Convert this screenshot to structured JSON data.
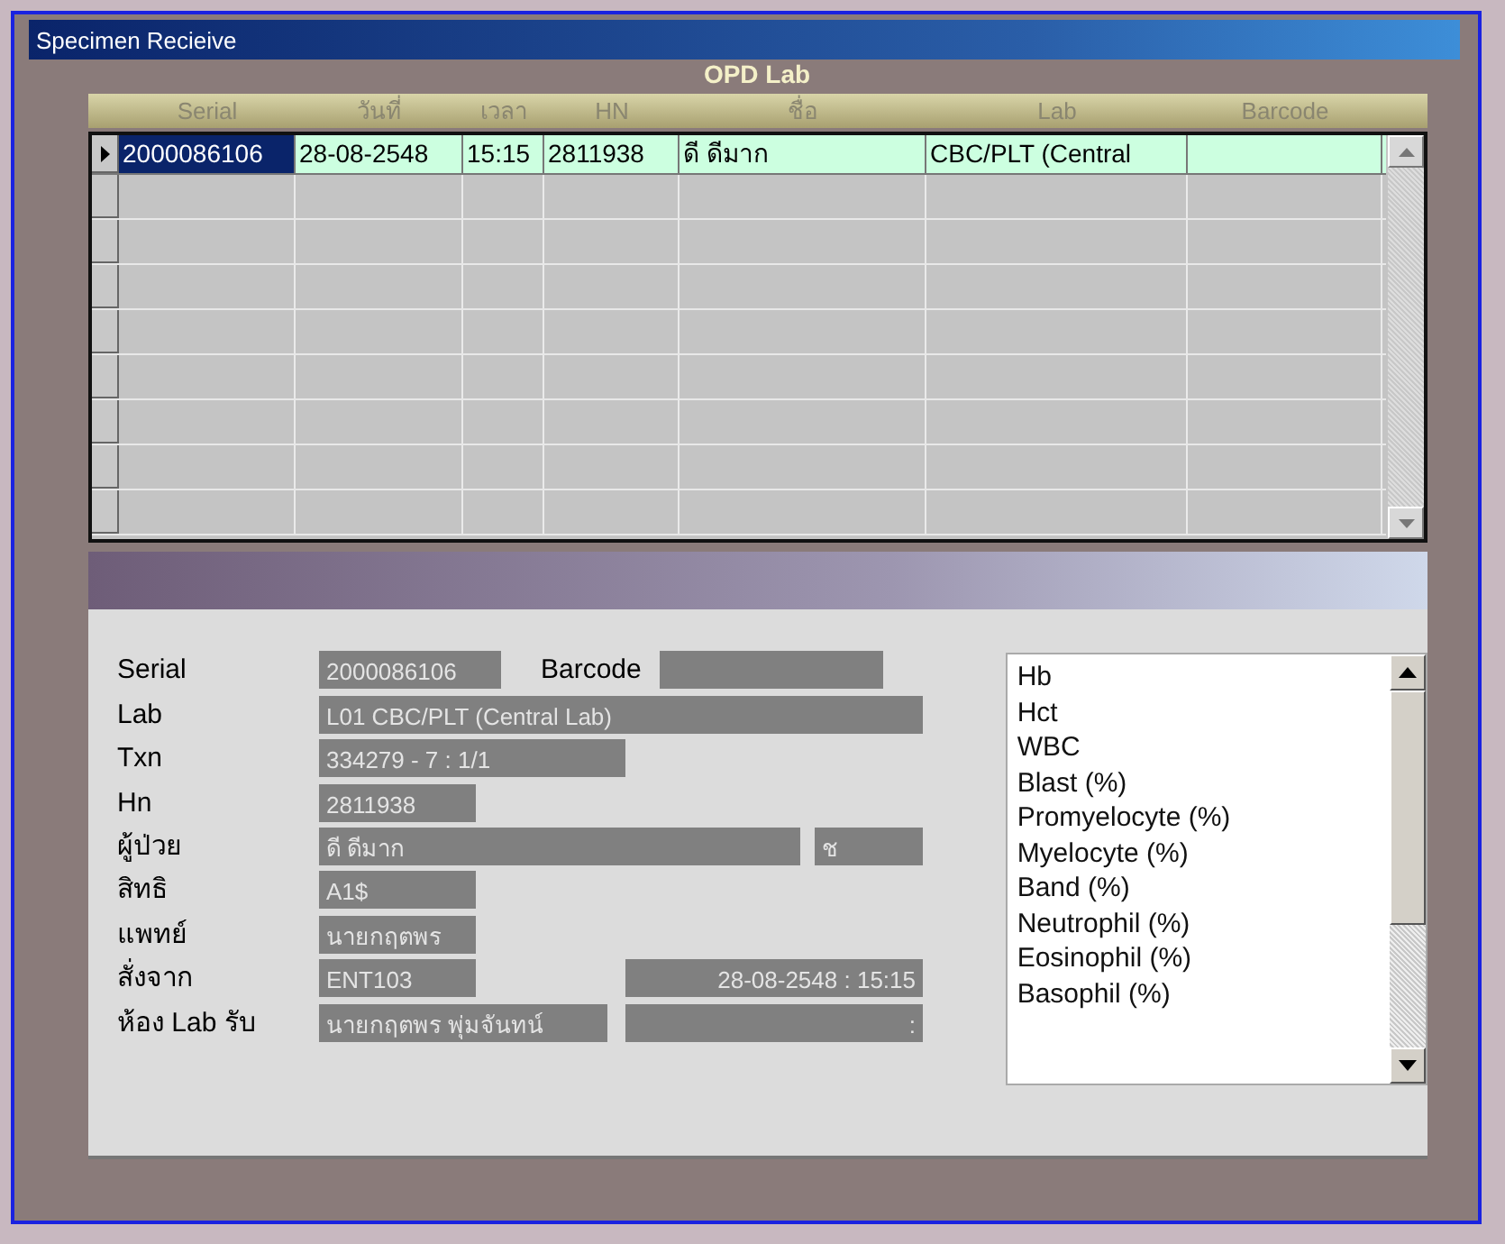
{
  "window": {
    "title": "Specimen Recieive"
  },
  "grid": {
    "title": "OPD Lab",
    "columns": [
      "Serial",
      "วันที่",
      "เวลา",
      "HN",
      "ชื่อ",
      "Lab",
      "Barcode"
    ],
    "rows": [
      {
        "selected": true,
        "current": true,
        "cells": [
          "2000086106",
          "28-08-2548",
          "15:15",
          "2811938",
          "ดี ดีมาก",
          "CBC/PLT (Central",
          ""
        ]
      }
    ]
  },
  "details": {
    "rows": [
      {
        "label": "Serial",
        "items": [
          {
            "kind": "field",
            "value": "2000086106"
          },
          {
            "kind": "label",
            "text": "Barcode"
          },
          {
            "kind": "field",
            "value": ""
          }
        ]
      },
      {
        "label": "Lab",
        "items": [
          {
            "kind": "field",
            "value": "L01 CBC/PLT (Central Lab)"
          }
        ]
      },
      {
        "label": "Txn",
        "items": [
          {
            "kind": "field",
            "value": "334279 - 7 : 1/1"
          }
        ]
      },
      {
        "label": "Hn",
        "items": [
          {
            "kind": "field",
            "value": "2811938"
          }
        ]
      },
      {
        "label": "ผู้ป่วย",
        "items": [
          {
            "kind": "field",
            "value": "ดี ดีมาก"
          },
          {
            "kind": "field",
            "value": "ช"
          }
        ]
      },
      {
        "label": "สิทธิ",
        "items": [
          {
            "kind": "field",
            "value": "A1$"
          }
        ]
      },
      {
        "label": "แพทย์",
        "items": [
          {
            "kind": "field",
            "value": "นายกฤตพร"
          }
        ]
      },
      {
        "label": "สั่งจาก",
        "items": [
          {
            "kind": "field",
            "value": "ENT103"
          },
          {
            "kind": "field",
            "value": "28-08-2548 : 15:15"
          }
        ]
      },
      {
        "label": "ห้อง Lab รับ",
        "items": [
          {
            "kind": "field",
            "value": "นายกฤตพร พุ่มจันทน์"
          },
          {
            "kind": "field",
            "value": ":"
          }
        ]
      }
    ]
  },
  "tests": [
    "Hb",
    "Hct",
    "WBC",
    "Blast (%)",
    "Promyelocyte (%)",
    "Myelocyte (%)",
    "Band (%)",
    "Neutrophil  (%)",
    "Eosinophil  (%)",
    "Basophil  (%)"
  ]
}
